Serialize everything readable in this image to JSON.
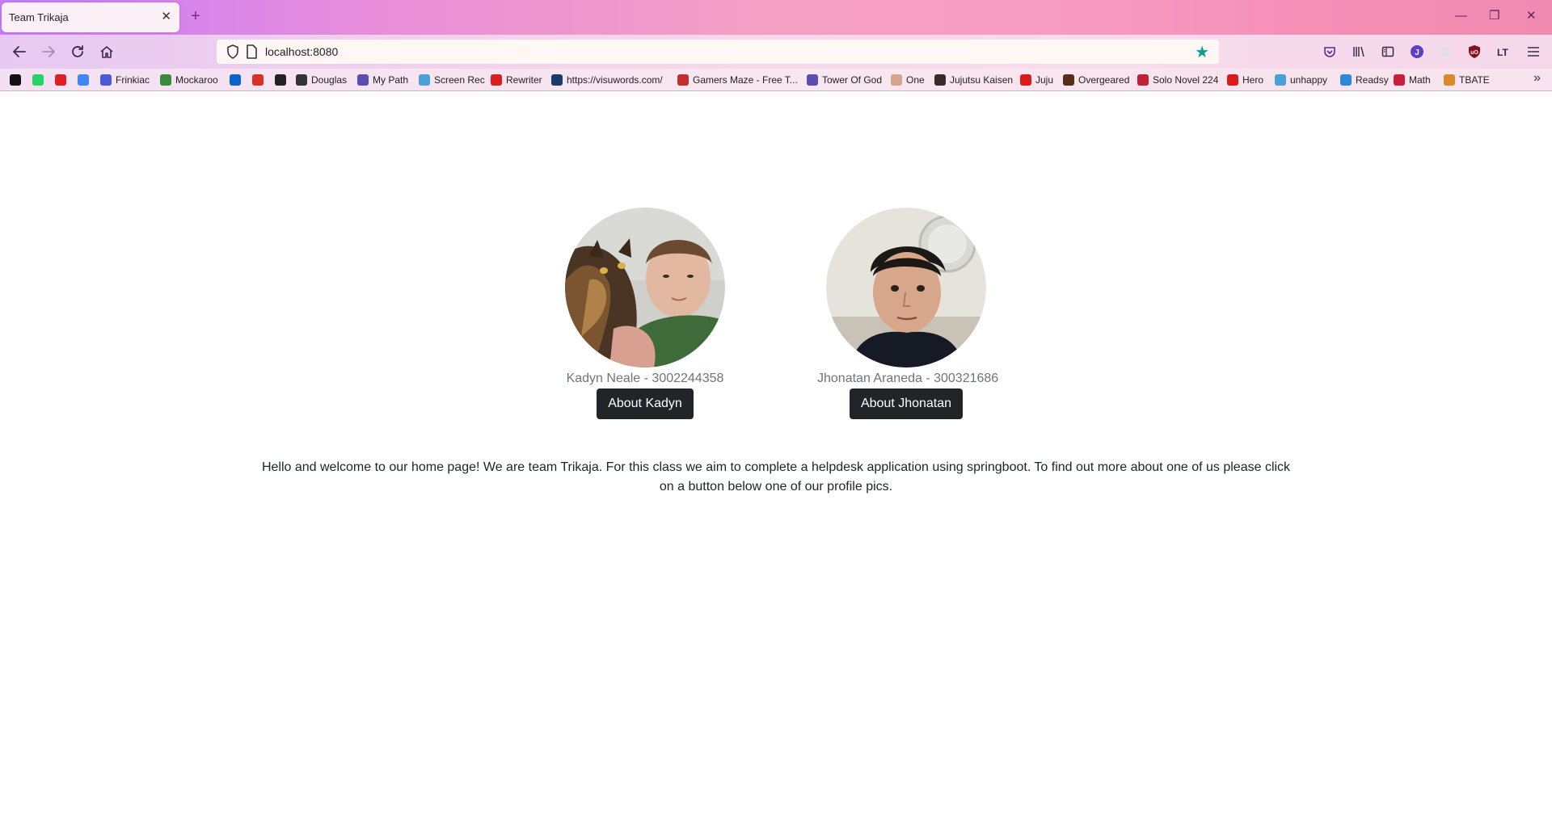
{
  "browser": {
    "tab_title": "Team Trikaja",
    "tab_close": "✕",
    "new_tab": "+",
    "url": "localhost:8080",
    "window_controls": {
      "minimize": "—",
      "restore": "❐",
      "close": "✕"
    },
    "toolbar_icons": [
      "pocket-icon",
      "library-icon",
      "sidebar-icon",
      "account-icon",
      "extension-icon",
      "ublock-icon",
      "languagetool-icon",
      "menu-icon"
    ],
    "accent": "#0e9a9a"
  },
  "bookmarks": [
    {
      "label": "",
      "icon": "bookmark-black-icon",
      "color": "#111111"
    },
    {
      "label": "",
      "icon": "whatsapp-icon",
      "color": "#25d366"
    },
    {
      "label": "",
      "icon": "red-app-icon",
      "color": "#e02020"
    },
    {
      "label": "",
      "icon": "translate-icon",
      "color": "#4285f4"
    },
    {
      "label": "Frinkiac",
      "icon": "frinkiac-icon",
      "color": "#4b5bd6"
    },
    {
      "label": "Mockaroo",
      "icon": "mockaroo-icon",
      "color": "#3a8a3a"
    },
    {
      "label": "",
      "icon": "outlook-icon",
      "color": "#0a64c8"
    },
    {
      "label": "",
      "icon": "gmail-icon",
      "color": "#d93025"
    },
    {
      "label": "",
      "icon": "bb-icon",
      "color": "#222222"
    },
    {
      "label": "Douglas",
      "icon": "douglas-icon",
      "color": "#333333"
    },
    {
      "label": "My Path",
      "icon": "globe-icon",
      "color": "#5a4fb0"
    },
    {
      "label": "Screen Rec",
      "icon": "screenrec-icon",
      "color": "#4aa0d8"
    },
    {
      "label": "Rewriter",
      "icon": "rewriter-icon",
      "color": "#d82020"
    },
    {
      "label": "https://visuwords.com/",
      "icon": "visuwords-icon",
      "color": "#1a3a6a"
    },
    {
      "label": "Gamers Maze - Free T...",
      "icon": "gamers-maze-icon",
      "color": "#c03030"
    },
    {
      "label": "Tower Of God",
      "icon": "globe-icon",
      "color": "#5a4fb0"
    },
    {
      "label": "One",
      "icon": "one-icon",
      "color": "#d4a58a"
    },
    {
      "label": "Jujutsu Kaisen",
      "icon": "jujutsu-icon",
      "color": "#3a2a2a"
    },
    {
      "label": "Juju",
      "icon": "viz-icon",
      "color": "#d81c1c"
    },
    {
      "label": "Overgeared",
      "icon": "overgeared-icon",
      "color": "#5a2a1a"
    },
    {
      "label": "Solo Novel 224",
      "icon": "solo-icon",
      "color": "#c0203a"
    },
    {
      "label": "Hero",
      "icon": "viz-icon",
      "color": "#d81c1c"
    },
    {
      "label": "unhappy",
      "icon": "unhappy-icon",
      "color": "#4aa0d8"
    },
    {
      "label": "Readsy",
      "icon": "readsy-icon",
      "color": "#2a8ad8"
    },
    {
      "label": "Math",
      "icon": "sy-icon",
      "color": "#c8203a"
    },
    {
      "label": "TBATE",
      "icon": "tbate-icon",
      "color": "#d88a2a"
    }
  ],
  "page": {
    "profiles": [
      {
        "caption": "Kadyn Neale - 3002244358",
        "button": "About Kadyn"
      },
      {
        "caption": "Jhonatan Araneda - 300321686",
        "button": "About Jhonatan"
      }
    ],
    "welcome": "Hello and welcome to our home page! We are team Trikaja. For this class we aim to complete a helpdesk application using springboot. To find out more about one of us please click on a button below one of our profile pics."
  }
}
